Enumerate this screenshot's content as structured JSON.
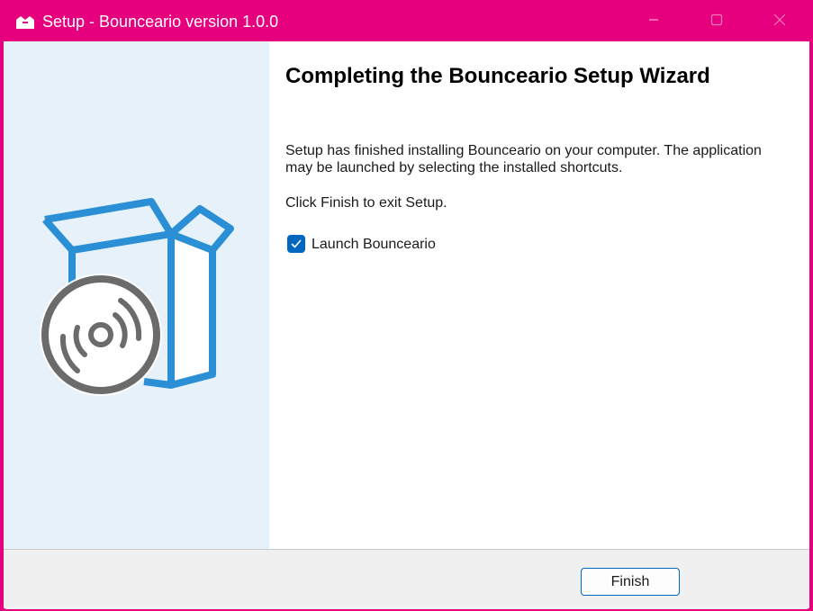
{
  "window": {
    "title": "Setup - Bounceario version 1.0.0",
    "app_icon": "installer-box-icon",
    "controls": {
      "minimize_icon": "minimize-icon",
      "maximize_icon": "maximize-icon",
      "close_icon": "close-icon"
    },
    "accent_color": "#e6007e"
  },
  "side_panel": {
    "illustration": "box-with-disc-icon",
    "background_color": "#e6f1f9",
    "art_colors": {
      "box": "#2b8fd6",
      "disc": "#6b6b6b"
    }
  },
  "main": {
    "heading": "Completing the Bounceario Setup Wizard",
    "description": "Setup has finished installing Bounceario on your computer. The application may be launched by selecting the installed shortcuts.",
    "instruction": "Click Finish to exit Setup.",
    "launch_checkbox": {
      "label": "Launch Bounceario",
      "checked": true
    }
  },
  "footer": {
    "finish_label": "Finish"
  }
}
